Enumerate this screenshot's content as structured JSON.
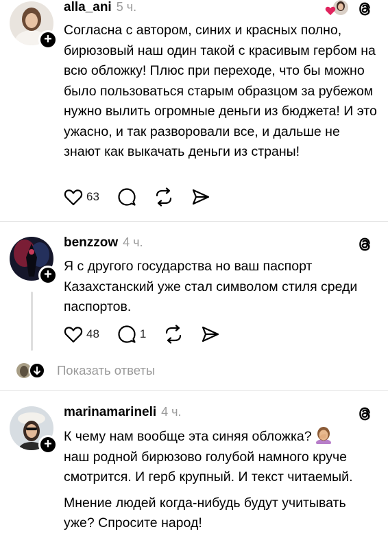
{
  "posts": [
    {
      "username": "alla_ani",
      "time": "5 ч.",
      "text": "Согласна с автором, синих и красных полно, бирюзовый наш один такой с красивым гербом на всю обложку! Плюс при переходе, что бы можно было пользоваться старым образцом за рубежом нужно вылить огромные деньги из бюджета! И это ужасно, и так разворовали все, и дальше не знают как выкачать деньги из страны!",
      "likes": "63"
    },
    {
      "username": "benzzow",
      "time": "4 ч.",
      "text": "Я с другого государства но ваш паспорт Казахстанский уже стал символом стиля среди паспортов.",
      "likes": "48",
      "replies": "1",
      "show_replies": "Показать ответы"
    },
    {
      "username": "marinamarineli",
      "time": "4 ч.",
      "text_line1": "К чему нам вообще эта синяя обложка?",
      "text_rest": "наш родной бирюзово голубой намного круче смотрится. И герб крупный. И текст читаемый.",
      "text_para2": "Мнение людей когда-нибудь будут учитывать уже? Спросите народ!"
    }
  ],
  "icons": {
    "follow": "plus-icon",
    "platform": "threads-icon",
    "like": "heart-icon",
    "reply": "comment-icon",
    "repost": "repost-icon",
    "share": "send-icon",
    "expand": "arrow-down-icon"
  },
  "colors": {
    "muted": "#9a9a9a",
    "divider": "#e2e2e2",
    "heart_red": "#e0245e"
  }
}
